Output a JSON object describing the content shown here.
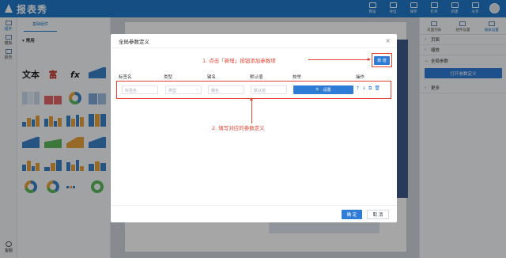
{
  "app": {
    "logo_text": "报表秀"
  },
  "topbar": {
    "actions": [
      {
        "label": "预览",
        "icon": "preview-icon"
      },
      {
        "label": "导出",
        "icon": "export-icon"
      },
      {
        "label": "保存",
        "icon": "save-icon"
      },
      {
        "label": "打开",
        "icon": "open-icon"
      },
      {
        "label": "新建",
        "icon": "new-icon"
      },
      {
        "label": "分享",
        "icon": "share-icon"
      }
    ]
  },
  "rail": {
    "items": [
      {
        "label": "组件",
        "icon": "component-icon"
      },
      {
        "label": "模板",
        "icon": "template-icon"
      },
      {
        "label": "报告",
        "icon": "report-icon"
      }
    ],
    "bottom_label": "客服"
  },
  "components": {
    "tab": "基础组件",
    "section": "常用",
    "big_tiles": [
      "文本",
      "富",
      "fx"
    ]
  },
  "right_panel": {
    "tabs": [
      {
        "label": "页面列表",
        "icon": "page-list-icon"
      },
      {
        "label": "组件设置",
        "icon": "component-settings-icon"
      },
      {
        "label": "报表设置",
        "icon": "report-settings-icon"
      }
    ],
    "sections": [
      "页面",
      "缩放",
      "全局参数",
      "更多"
    ],
    "open_params_button": "打开参数定义"
  },
  "modal": {
    "title": "全局参数定义",
    "add_button": "新 增",
    "annotation_1": "1. 点击「新增」按钮添加参数项",
    "annotation_2": "2. 填写对应的参数定义",
    "columns": [
      "标签名",
      "类型",
      "键名",
      "默认值",
      "枚举",
      "操作"
    ],
    "row": {
      "label_placeholder": "标签名",
      "type_placeholder": "类型",
      "key_placeholder": "键名",
      "default_placeholder": "默认值",
      "enum_button": "设置"
    },
    "ok_button": "确 定",
    "cancel_button": "取 消"
  }
}
